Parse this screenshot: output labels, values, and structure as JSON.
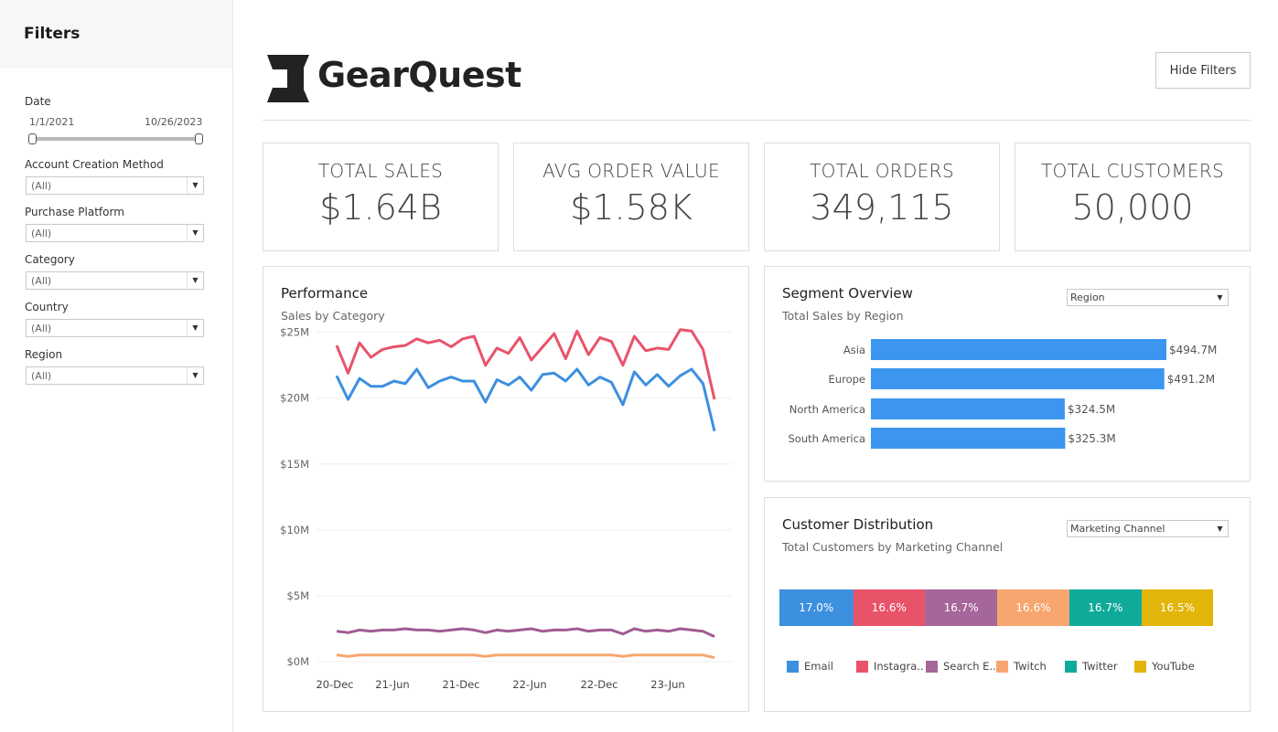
{
  "sidebar": {
    "title": "Filters",
    "date": {
      "label": "Date",
      "start": "1/1/2021",
      "end": "10/26/2023"
    },
    "filters": [
      {
        "label": "Account Creation Method",
        "value": "(All)"
      },
      {
        "label": "Purchase Platform",
        "value": "(All)"
      },
      {
        "label": "Category",
        "value": "(All)"
      },
      {
        "label": "Country",
        "value": "(All)"
      },
      {
        "label": "Region",
        "value": "(All)"
      }
    ]
  },
  "header": {
    "brand": "GearQuest",
    "hide_filters_label": "Hide Filters"
  },
  "kpis": [
    {
      "label": "TOTAL SALES",
      "value": "$1.64B"
    },
    {
      "label": "AVG ORDER VALUE",
      "value": "$1.58K"
    },
    {
      "label": "TOTAL ORDERS",
      "value": "349,115"
    },
    {
      "label": "TOTAL CUSTOMERS",
      "value": "50,000"
    }
  ],
  "performance": {
    "title": "Performance",
    "subtitle": "Sales by Category"
  },
  "segment": {
    "title": "Segment Overview",
    "subtitle": "Total Sales by Region",
    "select_value": "Region"
  },
  "distribution": {
    "title": "Customer Distribution",
    "subtitle": "Total Customers by Marketing Channel",
    "select_value": "Marketing Channel"
  },
  "chart_data": [
    {
      "type": "line",
      "title": "Performance",
      "subtitle": "Sales by Category",
      "y_ticks": [
        "$0M",
        "$5M",
        "$10M",
        "$15M",
        "$20M",
        "$25M"
      ],
      "x_ticks": [
        "20-Dec",
        "21-Jun",
        "21-Dec",
        "22-Jun",
        "22-Dec",
        "23-Jun"
      ],
      "ylim": [
        0,
        26.5
      ],
      "y_unit": "$M",
      "grid": true,
      "series": [
        {
          "color": "#e9536a",
          "values": [
            24.0,
            21.9,
            24.2,
            23.1,
            23.7,
            23.9,
            24.0,
            24.5,
            24.2,
            24.4,
            23.9,
            24.5,
            24.7,
            22.5,
            23.8,
            23.4,
            24.6,
            22.9,
            23.9,
            24.9,
            23.0,
            25.1,
            23.3,
            24.6,
            24.3,
            22.5,
            24.7,
            23.6,
            23.8,
            23.7,
            25.2,
            25.1,
            23.7,
            19.9
          ],
          "colorNote": ""
        },
        {
          "color": "#3d8fe0",
          "values": [
            21.7,
            19.9,
            21.5,
            20.9,
            20.9,
            21.3,
            21.1,
            22.2,
            20.8,
            21.3,
            21.6,
            21.3,
            21.3,
            19.7,
            21.4,
            21.0,
            21.6,
            20.6,
            21.8,
            21.9,
            21.3,
            22.2,
            21.0,
            21.6,
            21.2,
            19.5,
            22.0,
            21.0,
            21.8,
            20.9,
            21.7,
            22.2,
            21.1,
            17.5
          ]
        },
        {
          "color": "#a05c93",
          "values": [
            2.3,
            2.2,
            2.4,
            2.3,
            2.4,
            2.4,
            2.5,
            2.4,
            2.4,
            2.3,
            2.4,
            2.5,
            2.4,
            2.2,
            2.4,
            2.3,
            2.4,
            2.5,
            2.3,
            2.4,
            2.4,
            2.5,
            2.3,
            2.4,
            2.4,
            2.1,
            2.5,
            2.3,
            2.4,
            2.3,
            2.5,
            2.4,
            2.3,
            1.9
          ]
        },
        {
          "color": "#f7a66f",
          "values": [
            0.5,
            0.4,
            0.5,
            0.5,
            0.5,
            0.5,
            0.5,
            0.5,
            0.5,
            0.5,
            0.5,
            0.5,
            0.5,
            0.4,
            0.5,
            0.5,
            0.5,
            0.5,
            0.5,
            0.5,
            0.5,
            0.5,
            0.5,
            0.5,
            0.5,
            0.4,
            0.5,
            0.5,
            0.5,
            0.5,
            0.5,
            0.5,
            0.5,
            0.3
          ]
        }
      ]
    },
    {
      "type": "bar",
      "title": "Segment Overview",
      "subtitle": "Total Sales by Region",
      "orientation": "horizontal",
      "color": "#3c96f0",
      "categories": [
        "Asia",
        "Europe",
        "North America",
        "South America"
      ],
      "values": [
        494.7,
        491.2,
        324.5,
        325.3
      ],
      "labels": [
        "$494.7M",
        "$491.2M",
        "$324.5M",
        "$325.3M"
      ],
      "xlim": [
        0,
        494.7
      ]
    },
    {
      "type": "bar",
      "title": "Customer Distribution",
      "subtitle": "Total Customers by Marketing Channel",
      "orientation": "stacked-horizontal",
      "categories": [
        "Email",
        "Instagra..",
        "Search E..",
        "Twitch",
        "Twitter",
        "YouTube"
      ],
      "values": [
        17.0,
        16.6,
        16.7,
        16.6,
        16.7,
        16.5
      ],
      "labels": [
        "17.0%",
        "16.6%",
        "16.7%",
        "16.6%",
        "16.7%",
        "16.5%"
      ],
      "colors": [
        "#3d8fe0",
        "#e9536a",
        "#a5669a",
        "#f7a66f",
        "#10aa9a",
        "#e3b40a"
      ],
      "legend": "bottom"
    }
  ]
}
